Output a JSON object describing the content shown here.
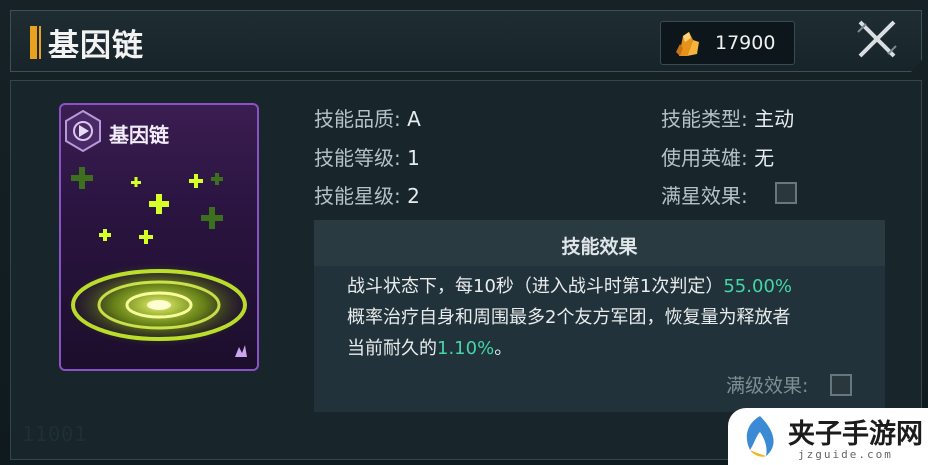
{
  "header": {
    "title": "基因链",
    "currency_value": "17900"
  },
  "card": {
    "name": "基因链"
  },
  "stats": {
    "quality_label": "技能品质:",
    "quality_value": "A",
    "level_label": "技能等级:",
    "level_value": "1",
    "star_label": "技能星级:",
    "star_value": "2",
    "type_label": "技能类型:",
    "type_value": "主动",
    "hero_label": "使用英雄:",
    "hero_value": "无",
    "max_star_label": "满星效果:"
  },
  "effect": {
    "title": "技能效果",
    "line1_a": "战斗状态下，每10秒（进入战斗时第1次判定）",
    "line1_pct": "55.00%",
    "line2": "概率治疗自身和周围最多2个友方军团，恢复量为释放者",
    "line3_a": "当前耐久的",
    "line3_pct": "1.10%",
    "line3_b": "。",
    "max_level_label": "满级效果:"
  },
  "footer": {
    "code": "11001"
  },
  "watermark": {
    "title": "夹子手游网",
    "url": "jzguide.com"
  },
  "colors": {
    "accent_orange": "#e9a21f",
    "highlight_green": "#43d6a6",
    "card_purple": "#8a52c4",
    "card_glow_green": "#c8ff1a"
  }
}
